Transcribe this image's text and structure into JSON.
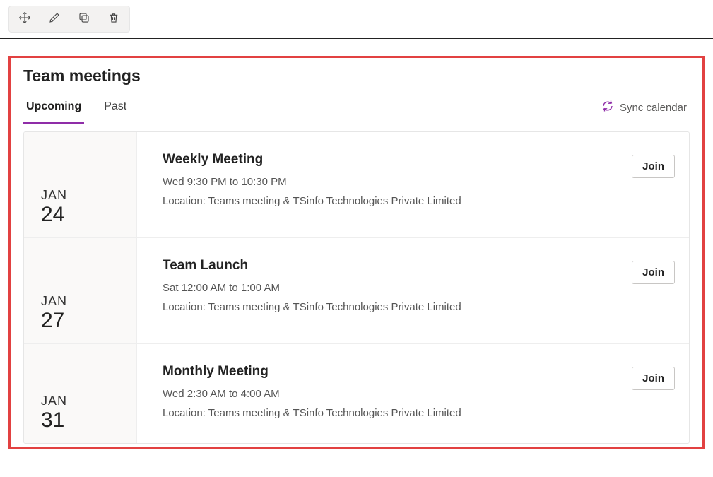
{
  "toolbar": {
    "tools": [
      "move",
      "edit",
      "copy",
      "delete"
    ]
  },
  "panel": {
    "title": "Team meetings",
    "tabs": {
      "upcoming": "Upcoming",
      "past": "Past"
    },
    "sync_label": "Sync calendar"
  },
  "meetings": [
    {
      "month": "JAN",
      "day": "24",
      "title": "Weekly Meeting",
      "time": "Wed 9:30 PM to 10:30 PM",
      "location": "Location: Teams meeting & TSinfo Technologies Private Limited",
      "join": "Join"
    },
    {
      "month": "JAN",
      "day": "27",
      "title": "Team Launch",
      "time": "Sat 12:00 AM to 1:00 AM",
      "location": "Location: Teams meeting & TSinfo Technologies Private Limited",
      "join": "Join"
    },
    {
      "month": "JAN",
      "day": "31",
      "title": "Monthly Meeting",
      "time": "Wed 2:30 AM to 4:00 AM",
      "location": "Location: Teams meeting & TSinfo Technologies Private Limited",
      "join": "Join"
    }
  ]
}
